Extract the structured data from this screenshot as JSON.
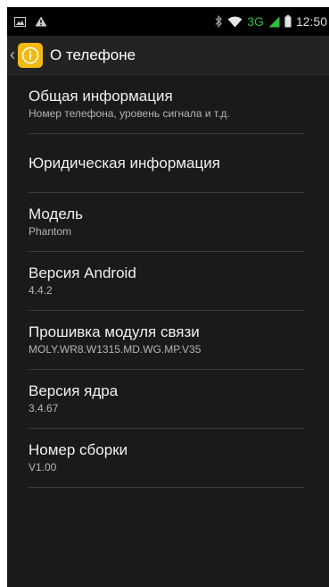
{
  "statusbar": {
    "left_icons": [
      "image-icon",
      "warning-icon"
    ],
    "right_icons": [
      "bluetooth-icon",
      "wifi-icon",
      "signal-icon",
      "battery-icon"
    ],
    "network_type": "3G",
    "time": "12:50"
  },
  "actionbar": {
    "title": "О телефоне",
    "icon": "info-icon"
  },
  "items": [
    {
      "title": "Общая информация",
      "subtitle": "Номер телефона, уровень сигнала и т.д."
    },
    {
      "title": "Юридическая информация",
      "subtitle": ""
    },
    {
      "title": "Модель",
      "subtitle": "Phantom"
    },
    {
      "title": "Версия Android",
      "subtitle": "4.4.2"
    },
    {
      "title": "Прошивка модуля связи",
      "subtitle": "MOLY.WR8.W1315.MD.WG.MP.V35"
    },
    {
      "title": "Версия ядра",
      "subtitle": "3.4.67"
    },
    {
      "title": "Номер сборки",
      "subtitle": "V1.00"
    }
  ],
  "colors": {
    "accent": "#f2b90f",
    "background": "#1a1a1a",
    "network": "#2fbf3f"
  }
}
